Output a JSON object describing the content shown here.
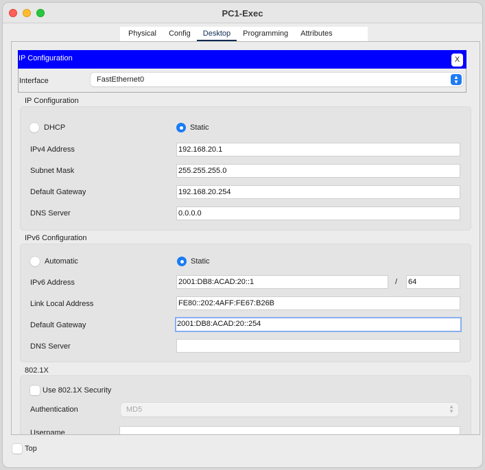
{
  "window": {
    "title": "PC1-Exec",
    "tabs": [
      {
        "label": "Physical",
        "active": false
      },
      {
        "label": "Config",
        "active": false
      },
      {
        "label": "Desktop",
        "active": true
      },
      {
        "label": "Programming",
        "active": false
      },
      {
        "label": "Attributes",
        "active": false
      }
    ]
  },
  "app": {
    "title": "IP Configuration",
    "close_label": "X",
    "interface_label": "Interface",
    "interface_value": "FastEthernet0"
  },
  "ipv4": {
    "section_title": "IP Configuration",
    "mode_options": [
      "DHCP",
      "Static"
    ],
    "selected_mode": "Static",
    "fields": [
      {
        "label": "IPv4 Address",
        "value": "192.168.20.1"
      },
      {
        "label": "Subnet Mask",
        "value": "255.255.255.0"
      },
      {
        "label": "Default Gateway",
        "value": "192.168.20.254"
      },
      {
        "label": "DNS Server",
        "value": "0.0.0.0"
      }
    ]
  },
  "ipv6": {
    "section_title": "IPv6 Configuration",
    "mode_options": [
      "Automatic",
      "Static"
    ],
    "selected_mode": "Static",
    "address_label": "IPv6 Address",
    "address_value": "2001:DB8:ACAD:20::1",
    "prefix_separator": "/",
    "prefix_value": "64",
    "link_local_label": "Link Local Address",
    "link_local_value": "FE80::202:4AFF:FE67:B26B",
    "gateway_label": "Default Gateway",
    "gateway_value": "2001:DB8:ACAD:20::254",
    "dns_label": "DNS Server",
    "dns_value": ""
  },
  "dot1x": {
    "section_title": "802.1X",
    "use_security_label": "Use 802.1X Security",
    "use_security_checked": false,
    "authentication_label": "Authentication",
    "authentication_value": "MD5",
    "username_label": "Username",
    "username_value": ""
  },
  "footer": {
    "top_label": "Top",
    "top_checked": false
  }
}
